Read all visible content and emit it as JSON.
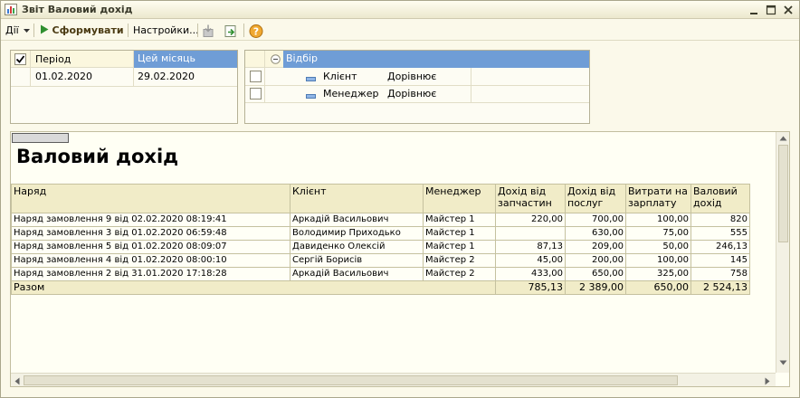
{
  "window": {
    "title": "Звіт  Валовий дохід",
    "controls": [
      "minimize-icon",
      "maximize-icon",
      "close-icon"
    ]
  },
  "toolbar": {
    "actions_label": "Дії",
    "generate_label": "Сформувати",
    "settings_label": "Настройки..."
  },
  "period": {
    "header_label": "Період",
    "preset": "Цей місяць",
    "start": "01.02.2020",
    "end": "29.02.2020"
  },
  "filter": {
    "title": "Відбір",
    "rows": [
      {
        "field": "Клієнт",
        "condition": "Дорівнює"
      },
      {
        "field": "Менеджер",
        "condition": "Дорівнює"
      }
    ]
  },
  "report": {
    "title": "Валовий дохід",
    "columns": [
      "Наряд",
      "Клієнт",
      "Менеджер",
      "Дохід від запчастин",
      "Дохід від послуг",
      "Витрати на зарплату",
      "Валовий дохід"
    ],
    "rows": [
      [
        "Наряд замовлення 9 від 02.02.2020 08:19:41",
        "Аркадій Васильович",
        "Майстер 1",
        "220,00",
        "700,00",
        "100,00",
        "820"
      ],
      [
        "Наряд замовлення 3 від 01.02.2020 06:59:48",
        "Володимир Приходько",
        "Майстер 1",
        "",
        "630,00",
        "75,00",
        "555"
      ],
      [
        "Наряд замовлення 5 від 01.02.2020 08:09:07",
        "Давиденко Олексій",
        "Майстер 1",
        "87,13",
        "209,00",
        "50,00",
        "246,13"
      ],
      [
        "Наряд замовлення 4 від 01.02.2020 08:00:10",
        "Сергій Борисів",
        "Майстер 2",
        "45,00",
        "200,00",
        "100,00",
        "145"
      ],
      [
        "Наряд замовлення 2 від 31.01.2020 17:18:28",
        "Аркадій Васильович",
        "Майстер 2",
        "433,00",
        "650,00",
        "325,00",
        "758"
      ]
    ],
    "totals": {
      "label": "Разом",
      "parts": "785,13",
      "services": "2 389,00",
      "salary": "650,00",
      "gross": "2 524,13"
    }
  },
  "colors": {
    "background": "#fbf9ea",
    "header_fill": "#f1ecc8",
    "selected_fill": "#6f9dd6",
    "accent_green": "#2f8f2f"
  }
}
